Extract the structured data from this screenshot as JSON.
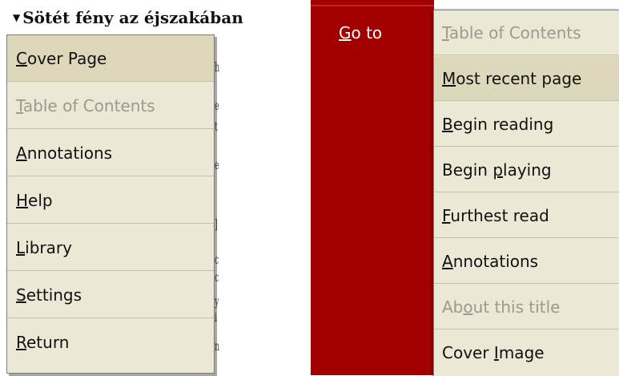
{
  "left": {
    "book_title": "Sötét fény az éjszakában",
    "menu_items": [
      {
        "pre": "",
        "key": "C",
        "post": "over Page",
        "state": "selected"
      },
      {
        "pre": "",
        "key": "T",
        "post": "able of Contents",
        "state": "disabled"
      },
      {
        "pre": "",
        "key": "A",
        "post": "nnotations",
        "state": "normal"
      },
      {
        "pre": "",
        "key": "H",
        "post": "elp",
        "state": "normal"
      },
      {
        "pre": "",
        "key": "L",
        "post": "ibrary",
        "state": "normal"
      },
      {
        "pre": "",
        "key": "S",
        "post": "ettings",
        "state": "normal"
      },
      {
        "pre": "",
        "key": "R",
        "post": "eturn",
        "state": "normal"
      }
    ]
  },
  "right": {
    "goto_label": {
      "pre": "",
      "key": "G",
      "post": "o to"
    },
    "menu_items": [
      {
        "pre": "",
        "key": "T",
        "post": "able of Contents",
        "state": "disabled"
      },
      {
        "pre": "",
        "key": "M",
        "post": "ost recent page",
        "state": "selected"
      },
      {
        "pre": "",
        "key": "B",
        "post": "egin reading",
        "state": "normal"
      },
      {
        "pre": "Begin ",
        "key": "p",
        "post": "laying",
        "state": "normal"
      },
      {
        "pre": "",
        "key": "F",
        "post": "urthest read",
        "state": "normal"
      },
      {
        "pre": "",
        "key": "A",
        "post": "nnotations",
        "state": "normal"
      },
      {
        "pre": "Ab",
        "key": "o",
        "post": "ut this title",
        "state": "disabled"
      },
      {
        "pre": "Cover ",
        "key": "I",
        "post": "mage",
        "state": "normal"
      }
    ]
  }
}
